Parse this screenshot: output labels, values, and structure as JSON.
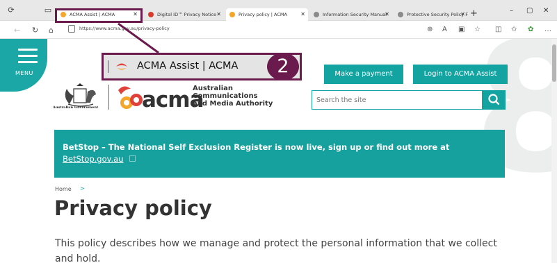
{
  "browser": {
    "tabs": [
      {
        "label": "ACMA Assist | ACMA",
        "active": true
      },
      {
        "label": "Digital ID™ Privacy Notice -",
        "active": false
      },
      {
        "label": "Privacy policy | ACMA",
        "active": true
      },
      {
        "label": "Information Security Manual",
        "active": false
      },
      {
        "label": "Protective Security Policy Fr",
        "active": false
      }
    ],
    "new_tab_symbol": "+",
    "url": "https://www.acma.gov.au/privacy-policy",
    "window_controls": {
      "minimize": "–",
      "maximize": "▢",
      "close": "✕"
    }
  },
  "site": {
    "menu_label": "MENU",
    "make_payment": "Make a payment",
    "login": "Login to ACMA Assist",
    "gov_label": "Australian Government",
    "logo_word": "acma",
    "logo_full": [
      "Australian",
      "Communications",
      "and Media Authority"
    ],
    "search_placeholder": "Search the site",
    "banner_text": "BetStop – The National Self Exclusion Register is now live, sign up or find out more at",
    "banner_link": "BetStop.gov.au",
    "breadcrumb_home": "Home",
    "breadcrumb_sep": ">",
    "page_title": "Privacy policy",
    "intro": "This policy describes how we manage and protect the personal information that we collect and hold."
  },
  "callout": {
    "label": "ACMA Assist | ACMA",
    "number": "2"
  },
  "colors": {
    "teal": "#13a4a2",
    "callout": "#6b1a4d",
    "acma_red": "#e0413a",
    "acma_orange": "#f4a62a"
  }
}
